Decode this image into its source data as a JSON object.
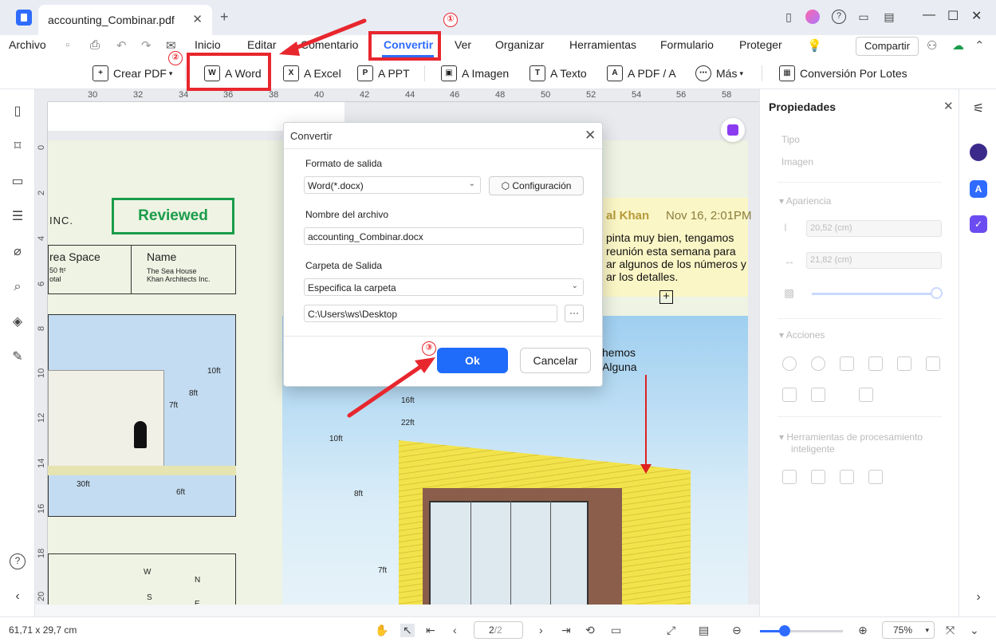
{
  "titlebar": {
    "tab_title": "accounting_Combinar.pdf",
    "tab_close": "✕",
    "new_tab": "+"
  },
  "menubar": {
    "archivo": "Archivo",
    "items": [
      "Inicio",
      "Editar",
      "Comentario",
      "Convertir",
      "Ver",
      "Organizar",
      "Herramientas",
      "Formulario",
      "Proteger"
    ],
    "active": "Convertir",
    "share_label": "Compartir"
  },
  "toolbar": {
    "items": [
      "Crear PDF",
      "A Word",
      "A Excel",
      "A PPT",
      "A Imagen",
      "A Texto",
      "A PDF / A",
      "Más",
      "Conversión Por Lotes"
    ],
    "icons": [
      "+",
      "W",
      "X",
      "P",
      "▣",
      "T",
      "A",
      "⋯",
      "▦"
    ]
  },
  "ruler": {
    "horizontal": [
      "30",
      "32",
      "34",
      "36",
      "38",
      "40",
      "42",
      "44",
      "46",
      "48",
      "50",
      "52",
      "54",
      "56",
      "58"
    ],
    "vertical": [
      "0",
      "2",
      "4",
      "6",
      "8",
      "10",
      "12",
      "14",
      "16",
      "18",
      "20"
    ]
  },
  "document": {
    "reviewed_stamp": "Reviewed",
    "inc": "INC.",
    "area_space": "rea Space",
    "area_sub1": "50 ft²",
    "area_sub2": "otal",
    "name_label": "Name",
    "name_sub1": "The Sea House",
    "name_sub2": "Khan Architects Inc.",
    "dims": [
      "10ft",
      "8ft",
      "7ft",
      "30ft",
      "6ft",
      "16ft",
      "22ft",
      "10ft",
      "8ft",
      "7ft"
    ],
    "compass": [
      "W",
      "N",
      "S",
      "E"
    ],
    "comment_author": "al Khan",
    "comment_date": "Nov 16, 2:01PM",
    "comment_lines": [
      "pinta muy bien, tengamos",
      "reunión esta semana para",
      "ar algunos de los números y",
      "ar los detalles."
    ],
    "drawing_note1": "hemos",
    "drawing_note2": "Alguna"
  },
  "dialog": {
    "title": "Convertir",
    "output_format_label": "Formato de salida",
    "output_format_value": "Word(*.docx)",
    "config_button": "Configuración",
    "filename_label": "Nombre del archivo",
    "filename_value": "accounting_Combinar.docx",
    "folder_label": "Carpeta de Salida",
    "folder_value": "Especifica la carpeta",
    "path_value": "C:\\Users\\ws\\Desktop",
    "dots": "···",
    "ok": "Ok",
    "cancel": "Cancelar"
  },
  "props": {
    "title": "Propiedades",
    "tipo": "Tipo",
    "imagen": "Imagen",
    "apariencia": "Apariencia",
    "height": "20,52 (cm)",
    "width": "21,82 (cm)",
    "acciones": "Acciones",
    "tools_title_1": "Herramientas de procesamiento",
    "tools_title_2": "inteligente"
  },
  "statusbar": {
    "size": "61,71 x 29,7 cm",
    "page": "2",
    "page_total": "/2",
    "zoom": "75%",
    "zoom_level_fraction": 0.3
  },
  "annotations": {
    "step1": "①",
    "step2": "②",
    "step3": "③",
    "color": "#e8262e"
  },
  "colors": {
    "accent": "#2f6bff",
    "ok_button": "#1f6bfa",
    "reviewed_green": "#1a9c4a"
  }
}
